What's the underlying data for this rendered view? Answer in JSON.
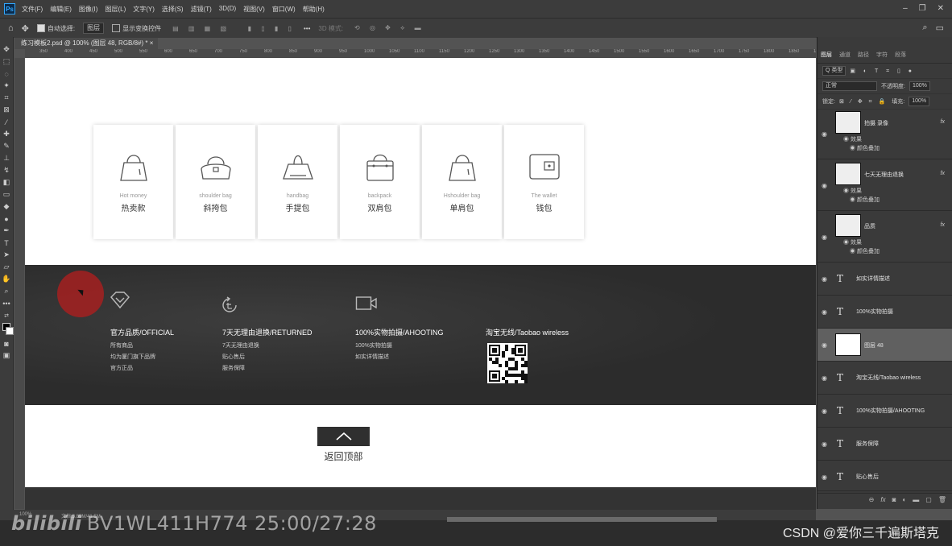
{
  "menubar": {
    "items": [
      "文件(F)",
      "编辑(E)",
      "图像(I)",
      "图层(L)",
      "文字(Y)",
      "选择(S)",
      "滤镜(T)",
      "3D(D)",
      "视图(V)",
      "窗口(W)",
      "帮助(H)"
    ]
  },
  "options": {
    "auto_select_label": "自动选择:",
    "auto_select_value": "图层",
    "show_transform_label": "显示变换控件",
    "mode_3d": "3D 模式:"
  },
  "document": {
    "tab_title": "练习模板2.psd @ 100% (图层 48, RGB/8#) *",
    "tab_close": "×",
    "ruler_ticks": [
      "350",
      "400",
      "450",
      "500",
      "550",
      "600",
      "650",
      "700",
      "750",
      "800",
      "850",
      "900",
      "950",
      "1000",
      "1050",
      "1100",
      "1150",
      "1200",
      "1250",
      "1300",
      "1350",
      "1400",
      "1450",
      "1500",
      "1550",
      "1600",
      "1650",
      "1700",
      "1750",
      "1800",
      "1850",
      "1900",
      "1950"
    ]
  },
  "canvas": {
    "categories": [
      {
        "en": "Hot money",
        "cn": "热卖款",
        "icon": "tote-bag-icon"
      },
      {
        "en": "shoulder bag",
        "cn": "斜挎包",
        "icon": "shoulder-bag-icon"
      },
      {
        "en": "handbag",
        "cn": "手提包",
        "icon": "handbag-icon"
      },
      {
        "en": "backpack",
        "cn": "双肩包",
        "icon": "backpack-icon"
      },
      {
        "en": "Hshoulder bag",
        "cn": "单肩包",
        "icon": "single-shoulder-bag-icon"
      },
      {
        "en": "The wallet",
        "cn": "钱包",
        "icon": "wallet-icon"
      }
    ],
    "footer": {
      "columns": [
        {
          "title": "官方品质/OFFICIAL",
          "lines": [
            "所有商品",
            "均为厦门旗下品牌",
            "官方正品"
          ],
          "icon": "diamond-icon"
        },
        {
          "title": "7天无理由退换/RETURNED",
          "lines": [
            "7天无理由退换",
            "贴心售后",
            "服务保障"
          ],
          "icon": "return-icon"
        },
        {
          "title": "100%实物拍摄/AHOOTING",
          "lines": [
            "100%实物拍摄",
            "如实详情描述"
          ],
          "icon": "video-camera-icon"
        },
        {
          "title": "淘宝无线/Taobao wireless",
          "lines": [],
          "icon": "qr-code-icon"
        }
      ]
    },
    "back_to_top": "返回顶部"
  },
  "status": {
    "zoom": "100%",
    "doc": "文档:5.85M/41.5M"
  },
  "panel": {
    "tabs": [
      "图层",
      "通道",
      "路径",
      "字符",
      "段落"
    ],
    "filter_label": "Q 类型",
    "blend_mode": "正常",
    "opacity_label": "不透明度:",
    "opacity_value": "100%",
    "lock_label": "锁定:",
    "fill_label": "填充:",
    "fill_value": "100%",
    "fx_label": "fx",
    "layers": [
      {
        "kind": "image",
        "name": "拍摄 录像",
        "fx": true,
        "effects_label": "效果",
        "effect": "颜色叠加"
      },
      {
        "kind": "image",
        "name": "七天无理由退换",
        "fx": true,
        "effects_label": "效果",
        "effect": "颜色叠加"
      },
      {
        "kind": "image",
        "name": "品质",
        "fx": true,
        "effects_label": "效果",
        "effect": "颜色叠加"
      },
      {
        "kind": "text",
        "name": "如实详情描述"
      },
      {
        "kind": "text",
        "name": "100%实物拍摄"
      },
      {
        "kind": "image",
        "name": "图层 48",
        "selected": true
      },
      {
        "kind": "text",
        "name": "淘宝无线/Taobao wireless"
      },
      {
        "kind": "text",
        "name": "100%实物拍摄/AHOOTING"
      },
      {
        "kind": "text",
        "name": "服务保障"
      },
      {
        "kind": "text",
        "name": "贴心售后"
      }
    ]
  },
  "overlay": {
    "watermark": "BV1WL411H774 25:00/27:28",
    "bili_logo": "bilibili",
    "credit": "CSDN @爱你三千遍斯塔克"
  }
}
